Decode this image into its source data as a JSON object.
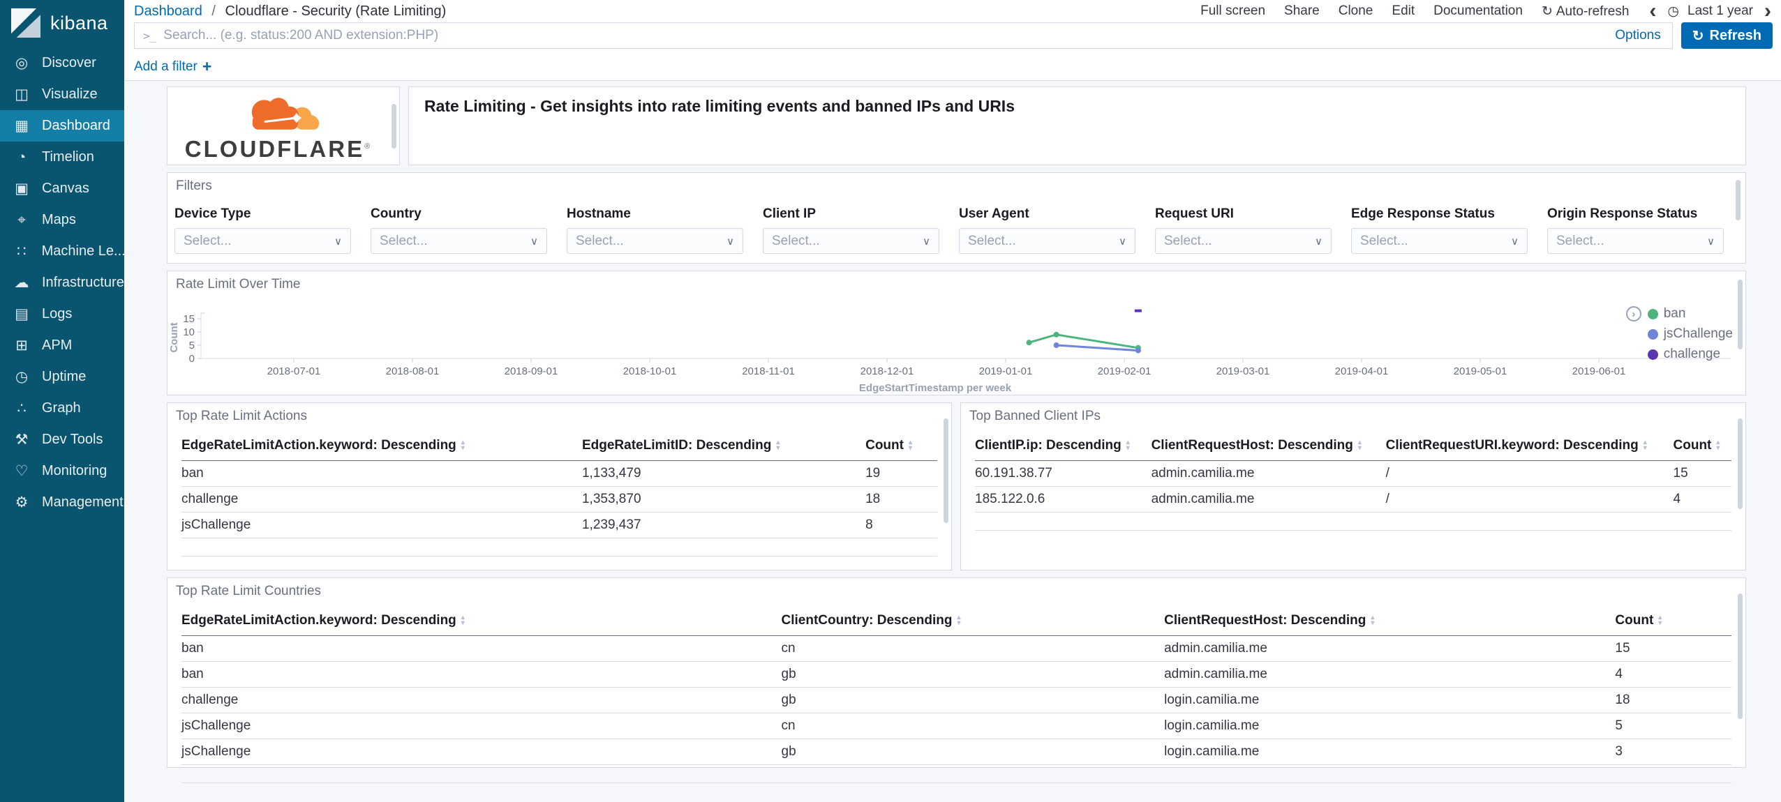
{
  "colors": {
    "accent": "#006BB4",
    "sidebar_bg": "#09546E",
    "sidebar_active": "#147FA6",
    "ban": "#4CB57D",
    "jsChallenge": "#6F85D8",
    "challenge": "#5A35B1"
  },
  "sidebar": {
    "logo_text": "kibana",
    "items": [
      {
        "id": "discover",
        "label": "Discover",
        "icon": "◎",
        "active": false
      },
      {
        "id": "visualize",
        "label": "Visualize",
        "icon": "◫",
        "active": false
      },
      {
        "id": "dashboard",
        "label": "Dashboard",
        "icon": "▦",
        "active": true
      },
      {
        "id": "timelion",
        "label": "Timelion",
        "icon": "◔",
        "active": false
      },
      {
        "id": "canvas",
        "label": "Canvas",
        "icon": "▣",
        "active": false
      },
      {
        "id": "maps",
        "label": "Maps",
        "icon": "⌖",
        "active": false
      },
      {
        "id": "machine-learning",
        "label": "Machine Le...",
        "icon": "∷",
        "active": false
      },
      {
        "id": "infrastructure",
        "label": "Infrastructure",
        "icon": "☁",
        "active": false
      },
      {
        "id": "logs",
        "label": "Logs",
        "icon": "▤",
        "active": false
      },
      {
        "id": "apm",
        "label": "APM",
        "icon": "⊞",
        "active": false
      },
      {
        "id": "uptime",
        "label": "Uptime",
        "icon": "◷",
        "active": false
      },
      {
        "id": "graph",
        "label": "Graph",
        "icon": "∴",
        "active": false
      },
      {
        "id": "dev-tools",
        "label": "Dev Tools",
        "icon": "⚒",
        "active": false
      },
      {
        "id": "monitoring",
        "label": "Monitoring",
        "icon": "♡",
        "active": false
      },
      {
        "id": "management",
        "label": "Management",
        "icon": "⚙",
        "active": false
      }
    ]
  },
  "topbar": {
    "breadcrumb_link": "Dashboard",
    "breadcrumb_sep": "/",
    "breadcrumb_current": "Cloudflare - Security (Rate Limiting)",
    "menu": [
      "Full screen",
      "Share",
      "Clone",
      "Edit",
      "Documentation"
    ],
    "auto_refresh_icon": "↻",
    "auto_refresh": "Auto-refresh",
    "prev": "‹",
    "clock_icon": "◷",
    "time_range": "Last 1 year",
    "next": "›"
  },
  "querybar": {
    "prompt": ">_",
    "placeholder": "Search... (e.g. status:200 AND extension:PHP)",
    "options": "Options",
    "refresh_icon": "↻",
    "refresh": "Refresh"
  },
  "filter_bar": {
    "add_filter": "Add a filter",
    "plus": "+"
  },
  "panels": {
    "logo": {
      "brand": "CLOUDFLARE",
      "reg": "®"
    },
    "description": {
      "text": "Rate Limiting - Get insights into rate limiting events and banned IPs and URIs"
    },
    "filters": {
      "title": "Filters",
      "placeholder": "Select...",
      "chevron": "∨",
      "fields": [
        "Device Type",
        "Country",
        "Hostname",
        "Client IP",
        "User Agent",
        "Request URI",
        "Edge Response Status",
        "Origin Response Status"
      ]
    },
    "chart": {
      "title": "Rate Limit Over Time"
    },
    "actions_table": {
      "title": "Top Rate Limit Actions",
      "columns": [
        "EdgeRateLimitAction.keyword: Descending",
        "EdgeRateLimitID: Descending",
        "Count"
      ],
      "rows": [
        [
          "ban",
          "1,133,479",
          "19"
        ],
        [
          "challenge",
          "1,353,870",
          "18"
        ],
        [
          "jsChallenge",
          "1,239,437",
          "8"
        ]
      ]
    },
    "banned_table": {
      "title": "Top Banned Client IPs",
      "columns": [
        "ClientIP.ip: Descending",
        "ClientRequestHost: Descending",
        "ClientRequestURI.keyword: Descending",
        "Count"
      ],
      "rows": [
        [
          "60.191.38.77",
          "admin.camilia.me",
          "/",
          "15"
        ],
        [
          "185.122.0.6",
          "admin.camilia.me",
          "/",
          "4"
        ]
      ]
    },
    "countries_table": {
      "title": "Top Rate Limit Countries",
      "columns": [
        "EdgeRateLimitAction.keyword: Descending",
        "ClientCountry: Descending",
        "ClientRequestHost: Descending",
        "Count"
      ],
      "rows": [
        [
          "ban",
          "cn",
          "admin.camilia.me",
          "15"
        ],
        [
          "ban",
          "gb",
          "admin.camilia.me",
          "4"
        ],
        [
          "challenge",
          "gb",
          "login.camilia.me",
          "18"
        ],
        [
          "jsChallenge",
          "cn",
          "login.camilia.me",
          "5"
        ],
        [
          "jsChallenge",
          "gb",
          "login.camilia.me",
          "3"
        ]
      ]
    }
  },
  "chart_data": {
    "type": "line",
    "title": "Rate Limit Over Time",
    "xlabel": "EdgeStartTimestamp per week",
    "ylabel": "Count",
    "ylim": [
      0,
      15
    ],
    "y_ticks": [
      0,
      5,
      10,
      15
    ],
    "x_ticks": [
      "2018-07-01",
      "2018-08-01",
      "2018-09-01",
      "2018-10-01",
      "2018-11-01",
      "2018-12-01",
      "2019-01-01",
      "2019-02-01",
      "2019-03-01",
      "2019-04-01",
      "2019-05-01",
      "2019-06-01"
    ],
    "grid": false,
    "legend_position": "right",
    "series": [
      {
        "name": "ban",
        "color": "#4CB57D",
        "points": [
          [
            "2019-01-07",
            6
          ],
          [
            "2019-01-14",
            9
          ],
          [
            "2019-02-04",
            4
          ]
        ]
      },
      {
        "name": "jsChallenge",
        "color": "#6F85D8",
        "points": [
          [
            "2019-01-14",
            5
          ],
          [
            "2019-02-04",
            3
          ]
        ]
      },
      {
        "name": "challenge",
        "color": "#5A35B1",
        "points": [
          [
            "2019-02-04",
            18
          ]
        ]
      }
    ]
  }
}
